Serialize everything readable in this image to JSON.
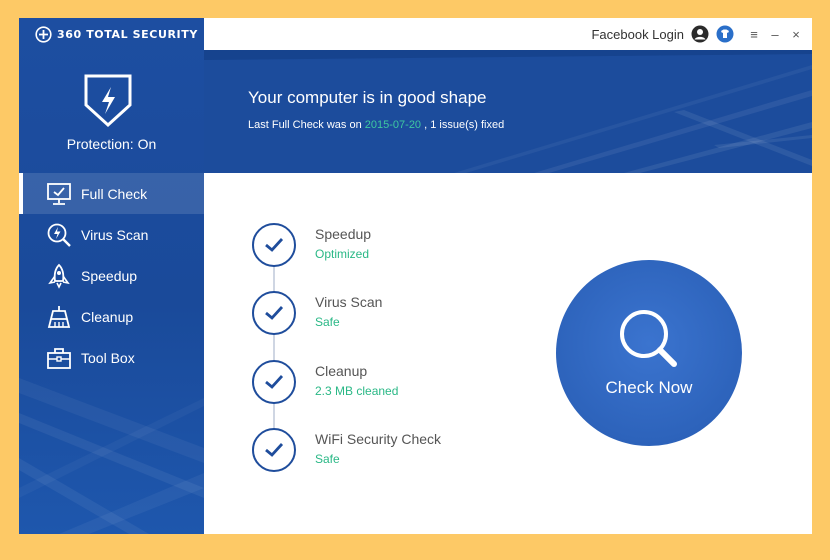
{
  "app": {
    "title": "360 TOTAL SECURITY",
    "protection_status": "Protection: On"
  },
  "titlebar": {
    "login_label": "Facebook Login",
    "menu_glyph": "≡",
    "minimize_glyph": "–",
    "close_glyph": "×"
  },
  "banner": {
    "title": "Your computer is in good shape",
    "subtitle_prefix": "Last Full Check was on ",
    "last_check_date": "2015-07-20",
    "subtitle_suffix": " , 1 issue(s) fixed"
  },
  "sidebar": {
    "items": [
      {
        "label": "Full Check",
        "icon": "monitor-check-icon",
        "active": true
      },
      {
        "label": "Virus Scan",
        "icon": "virus-scan-icon",
        "active": false
      },
      {
        "label": "Speedup",
        "icon": "rocket-icon",
        "active": false
      },
      {
        "label": "Cleanup",
        "icon": "broom-icon",
        "active": false
      },
      {
        "label": "Tool Box",
        "icon": "toolbox-icon",
        "active": false
      }
    ]
  },
  "checks": [
    {
      "name": "Speedup",
      "status": "Optimized"
    },
    {
      "name": "Virus Scan",
      "status": "Safe"
    },
    {
      "name": "Cleanup",
      "status": "2.3 MB cleaned"
    },
    {
      "name": "WiFi Security Check",
      "status": "Safe"
    }
  ],
  "action": {
    "check_now_label": "Check Now"
  },
  "colors": {
    "brand_blue": "#1c4c9c",
    "accent_green": "#2ab886",
    "frame_yellow": "#fdc966"
  }
}
